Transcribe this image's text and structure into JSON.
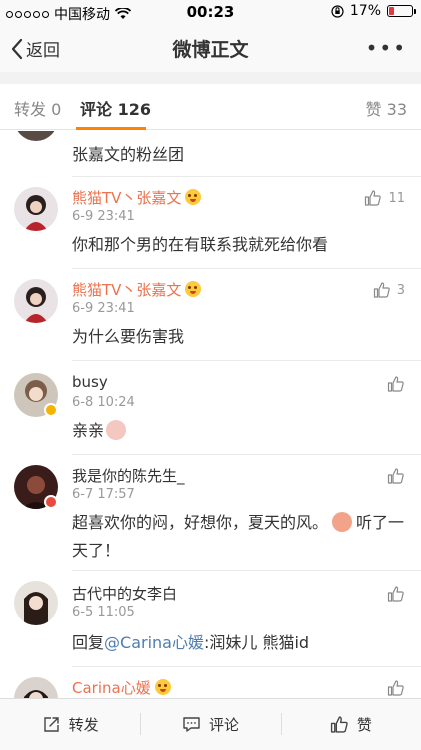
{
  "status_bar": {
    "carrier": "中国移动",
    "time": "00:23",
    "battery": "17%"
  },
  "nav": {
    "back_label": "返回",
    "title": "微博正文",
    "more": "•••"
  },
  "tabs": {
    "repost": "转发 0",
    "comments": "评论 126",
    "likes": "赞 33"
  },
  "comments": [
    {
      "text": "张嘉文的粉丝团"
    },
    {
      "username": "熊猫TV丶张嘉文",
      "time": "6-9 23:41",
      "text": "你和那个男的在有联系我就死给你看",
      "likes": "11"
    },
    {
      "username": "熊猫TV丶张嘉文",
      "time": "6-9 23:41",
      "text": "为什么要伤害我",
      "likes": "3"
    },
    {
      "username": "busy",
      "time": "6-8 10:24",
      "text": "亲亲"
    },
    {
      "username": "我是你的陈先生_",
      "time": "6-7 17:57",
      "text_a": "超喜欢你的闷，好想你，夏天的风。",
      "text_b": "听了一天了！"
    },
    {
      "username": "古代中的女李白",
      "time": "6-5 11:05",
      "text_prefix": "回复",
      "mention": "@Carina心媛",
      "text_suffix": ":润妹儿 熊猫id"
    },
    {
      "username": "Carina心媛"
    }
  ],
  "toolbar": {
    "repost": "转发",
    "comment": "评论",
    "like": "赞"
  },
  "colors": {
    "accent": "#ff8200",
    "vip_name": "#eb7350",
    "mention": "#507daf"
  }
}
